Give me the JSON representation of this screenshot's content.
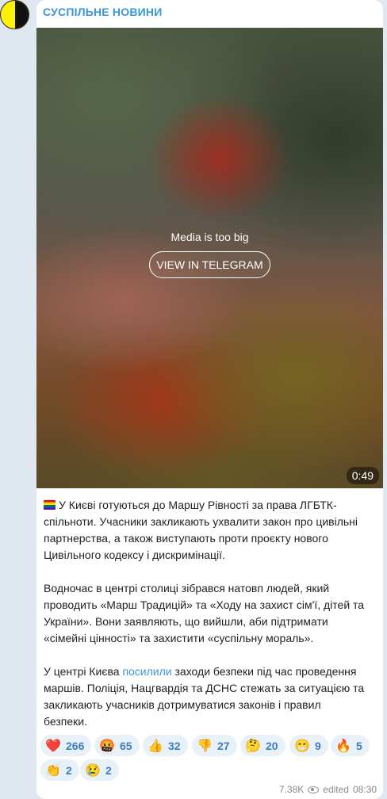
{
  "channel": {
    "name": "СУСПІЛЬНЕ НОВИНИ"
  },
  "media": {
    "notice": "Media is too big",
    "button_label": "VIEW IN TELEGRAM",
    "duration": "0:49"
  },
  "post": {
    "p1": [
      "У Києві готуються до Маршу Рівності за права ЛГБТК-",
      "спільноти. Учасники закликають ухвалити закон про цивільні",
      "партнерства, а також виступають проти проєкту нового",
      "Цивільного кодексу і дискримінації."
    ],
    "p2": [
      "Водночас в центрі столиці зібрався натовп людей, який",
      "проводить «Марш Традицій» та «Ходу на захист сім'ї, дітей та",
      "України». Вони заявляють, що вийшли, аби підтримати",
      "«сімейні цінності» та захистити «суспільну мораль»."
    ],
    "p3": {
      "line1_before": "У центрі Києва ",
      "line1_link": "посилили",
      "line1_after": " заходи безпеки під час проведення",
      "lines": [
        "маршів. Поліція, Нацгвардія та ДСНС стежать за ситуацією та",
        "закликають учасників дотримуватися законів і правил",
        "безпеки."
      ]
    }
  },
  "reactions": [
    {
      "emoji": "❤️",
      "icon": "red-heart",
      "count": "266"
    },
    {
      "emoji": "🤬",
      "icon": "angry-face",
      "count": "65"
    },
    {
      "emoji": "👍",
      "icon": "thumbs-up",
      "count": "32"
    },
    {
      "emoji": "👎",
      "icon": "thumbs-down",
      "count": "27"
    },
    {
      "emoji": "🤔",
      "icon": "thinking-face",
      "count": "20"
    },
    {
      "emoji": "😁",
      "icon": "grinning-face",
      "count": "9"
    },
    {
      "emoji": "🔥",
      "icon": "fire",
      "count": "5"
    },
    {
      "emoji": "👏",
      "icon": "clapping-hands",
      "count": "2"
    },
    {
      "emoji": "😢",
      "icon": "crying-face",
      "count": "2"
    }
  ],
  "meta": {
    "views": "7.38K",
    "edited": "edited",
    "time": "08:30"
  },
  "colors": {
    "accent": "#3a95d6",
    "reaction_bg": "#e8f0f8",
    "page_bg": "#dfe7f0"
  }
}
